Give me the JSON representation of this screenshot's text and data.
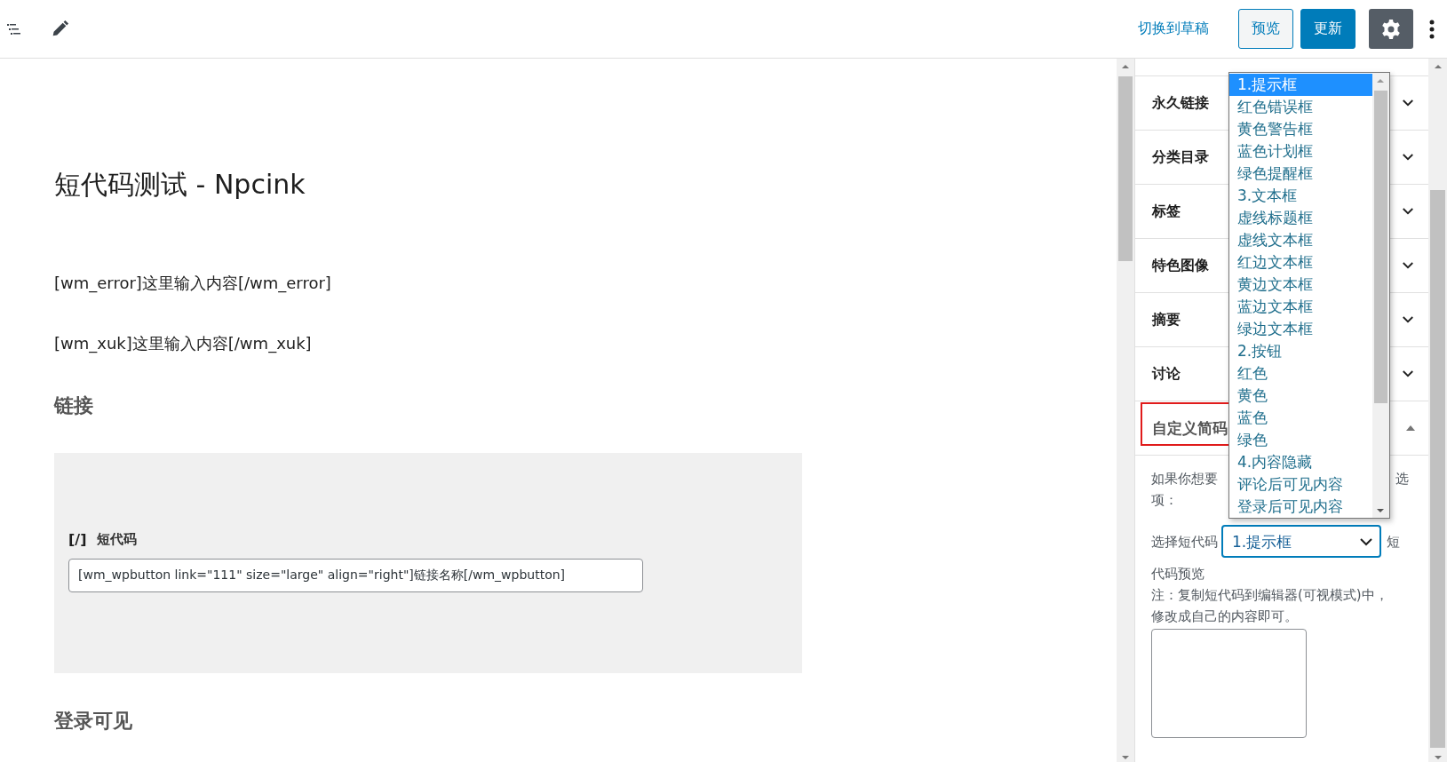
{
  "header": {
    "switch_link": "切换到草稿",
    "preview_button": "预览",
    "update_button": "更新",
    "settings": {
      "pressed": true
    }
  },
  "editor": {
    "title": "短代码测试 - Npcink",
    "blocks": [
      {
        "kind": "paragraph",
        "text": "[wm_error]这里输入内容[/wm_error]"
      },
      {
        "kind": "paragraph",
        "text": "[wm_xuk]这里输入内容[/wm_xuk]"
      },
      {
        "kind": "heading",
        "text": "链接"
      },
      {
        "kind": "shortcode",
        "icon_text": "[/]",
        "label": "短代码",
        "value": "[wm_wpbutton link=\"111\" size=\"large\" align=\"right\"]链接名称[/wm_wpbutton]"
      },
      {
        "kind": "heading",
        "text": "登录可见"
      }
    ]
  },
  "sidebar": {
    "panels": [
      {
        "title": "永久链接",
        "expanded": false,
        "highlighted": false
      },
      {
        "title": "分类目录",
        "expanded": false,
        "highlighted": false
      },
      {
        "title": "标签",
        "expanded": false,
        "highlighted": false
      },
      {
        "title": "特色图像",
        "expanded": false,
        "highlighted": false
      },
      {
        "title": "摘要",
        "expanded": false,
        "highlighted": false
      },
      {
        "title": "讨论",
        "expanded": false,
        "highlighted": false
      },
      {
        "title": "自定义简码",
        "expanded": true,
        "highlighted": true
      }
    ],
    "custom_shortcode": {
      "hint_start": "如果你想要",
      "hint_end": "选",
      "hint_line2": "项：",
      "select_label": "选择短代码",
      "select_value": "1.提示框",
      "after_select": "短",
      "preview_label": "代码预览",
      "note_line1": "注：复制短代码到编辑器(可视模式)中，",
      "note_line2": "修改成自己的内容即可。",
      "open": true,
      "options": [
        {
          "label": "1.提示框",
          "selected": true
        },
        {
          "label": "红色错误框",
          "selected": false
        },
        {
          "label": "黄色警告框",
          "selected": false
        },
        {
          "label": "蓝色计划框",
          "selected": false
        },
        {
          "label": "绿色提醒框",
          "selected": false
        },
        {
          "label": "3.文本框",
          "selected": false
        },
        {
          "label": "虚线标题框",
          "selected": false
        },
        {
          "label": "虚线文本框",
          "selected": false
        },
        {
          "label": "红边文本框",
          "selected": false
        },
        {
          "label": "黄边文本框",
          "selected": false
        },
        {
          "label": "蓝边文本框",
          "selected": false
        },
        {
          "label": "绿边文本框",
          "selected": false
        },
        {
          "label": "2.按钮",
          "selected": false
        },
        {
          "label": "红色",
          "selected": false
        },
        {
          "label": "黄色",
          "selected": false
        },
        {
          "label": "蓝色",
          "selected": false
        },
        {
          "label": "绿色",
          "selected": false
        },
        {
          "label": "4.内容隐藏",
          "selected": false
        },
        {
          "label": "评论后可见内容",
          "selected": false
        },
        {
          "label": "登录后可见内容",
          "selected": false
        }
      ]
    }
  }
}
